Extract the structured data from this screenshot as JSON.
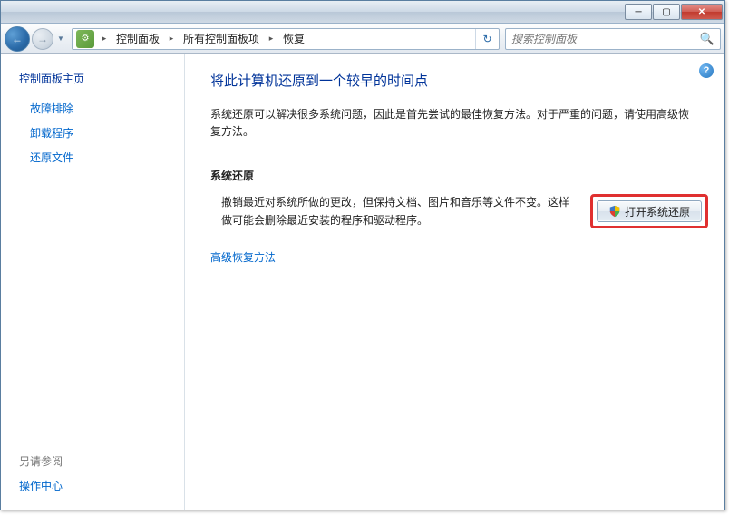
{
  "titlebar": {
    "min_glyph": "─",
    "max_glyph": "▢",
    "close_glyph": "✕"
  },
  "nav": {
    "back_glyph": "←",
    "fwd_glyph": "→",
    "dropdown_glyph": "▼",
    "refresh_glyph": "↻"
  },
  "breadcrumbs": {
    "icon_glyph": "⚙",
    "arrow": "▸",
    "items": [
      "控制面板",
      "所有控制面板项",
      "恢复"
    ]
  },
  "search": {
    "placeholder": "搜索控制面板",
    "icon_glyph": "🔍"
  },
  "sidebar": {
    "home": "控制面板主页",
    "links": [
      "故障排除",
      "卸载程序",
      "还原文件"
    ],
    "see_also_header": "另请参阅",
    "see_also": [
      "操作中心"
    ]
  },
  "main": {
    "help_glyph": "?",
    "title": "将此计算机还原到一个较早的时间点",
    "intro": "系统还原可以解决很多系统问题，因此是首先尝试的最佳恢复方法。对于严重的问题，请使用高级恢复方法。",
    "section_heading": "系统还原",
    "restore_desc": "撤销最近对系统所做的更改，但保持文档、图片和音乐等文件不变。这样做可能会删除最近安装的程序和驱动程序。",
    "button_label": "打开系统还原",
    "advanced_link": "高级恢复方法"
  }
}
